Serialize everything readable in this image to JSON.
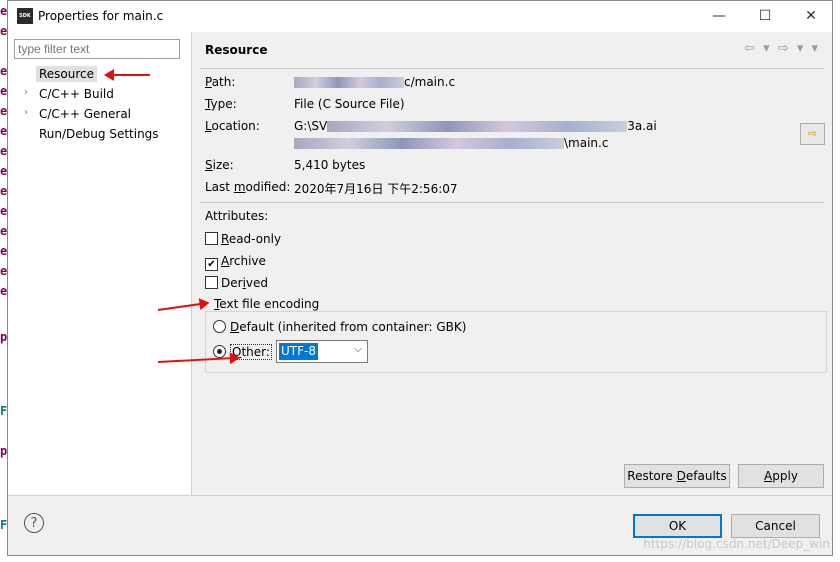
{
  "window": {
    "title": "Properties for main.c",
    "icon_text": "SDK",
    "minimize_glyph": "—",
    "maximize_glyph": "☐",
    "close_glyph": "✕"
  },
  "filter": {
    "placeholder": "type filter text"
  },
  "tree": [
    {
      "label": "Resource",
      "selected": true,
      "expandable": false
    },
    {
      "label": "C/C++ Build",
      "selected": false,
      "expandable": true
    },
    {
      "label": "C/C++ General",
      "selected": false,
      "expandable": true
    },
    {
      "label": "Run/Debug Settings",
      "selected": false,
      "expandable": false
    }
  ],
  "page": {
    "title": "Resource",
    "nav_icons": "⇦ ▾ ⇨ ▾ ▾"
  },
  "properties": {
    "path_label": "Path:",
    "path_suffix": "c/main.c",
    "type_label": "Type:",
    "type_value": "File  (C Source File)",
    "location_label": "Location:",
    "location_line1_prefix": "G:\\SV",
    "location_line1_suffix": "3a.ai",
    "location_line2_suffix": "\\main.c",
    "size_label": "Size:",
    "size_value": "5,410  bytes",
    "modified_label": "Last modified:",
    "modified_value": "2020年7月16日 下午2:56:07"
  },
  "attributes": {
    "label": "Attributes:",
    "readonly": {
      "label": "Read-only",
      "checked": false
    },
    "archive": {
      "label": "Archive",
      "checked": true
    },
    "derived": {
      "label": "Derived",
      "checked": false
    }
  },
  "encoding": {
    "group_title": "Text file encoding",
    "default_label": "Default (inherited from container: GBK)",
    "other_label": "Other:",
    "selected": "other",
    "other_value": "UTF-8"
  },
  "buttons": {
    "restore_defaults": "Restore Defaults",
    "apply": "Apply",
    "ok": "OK",
    "cancel": "Cancel",
    "help": "?"
  },
  "watermark": "https://blog.csdn.net/Deep_win",
  "colors": {
    "accent": "#0078d7",
    "annotation_arrow": "#e01010",
    "editor_keyword": "#7f0055"
  }
}
